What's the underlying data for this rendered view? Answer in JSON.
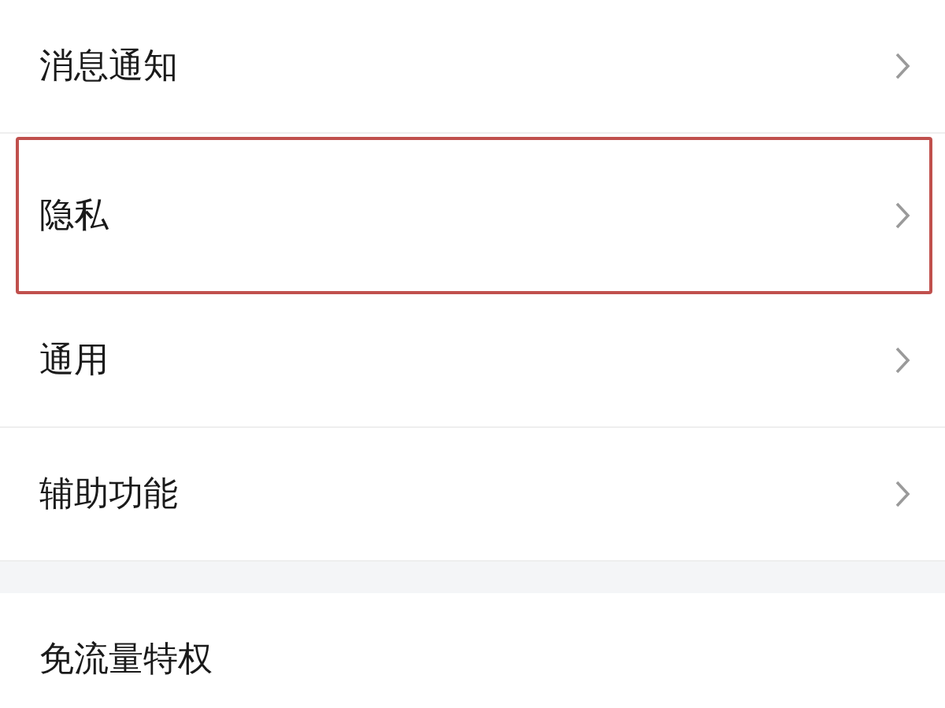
{
  "groups": [
    {
      "items": [
        {
          "label": "消息通知",
          "chevron": true,
          "highlighted": false
        },
        {
          "label": "隐私",
          "chevron": true,
          "highlighted": true
        },
        {
          "label": "通用",
          "chevron": true,
          "highlighted": false
        },
        {
          "label": "辅助功能",
          "chevron": true,
          "highlighted": false
        }
      ]
    },
    {
      "items": [
        {
          "label": "免流量特权",
          "chevron": false,
          "highlighted": false
        }
      ]
    }
  ]
}
